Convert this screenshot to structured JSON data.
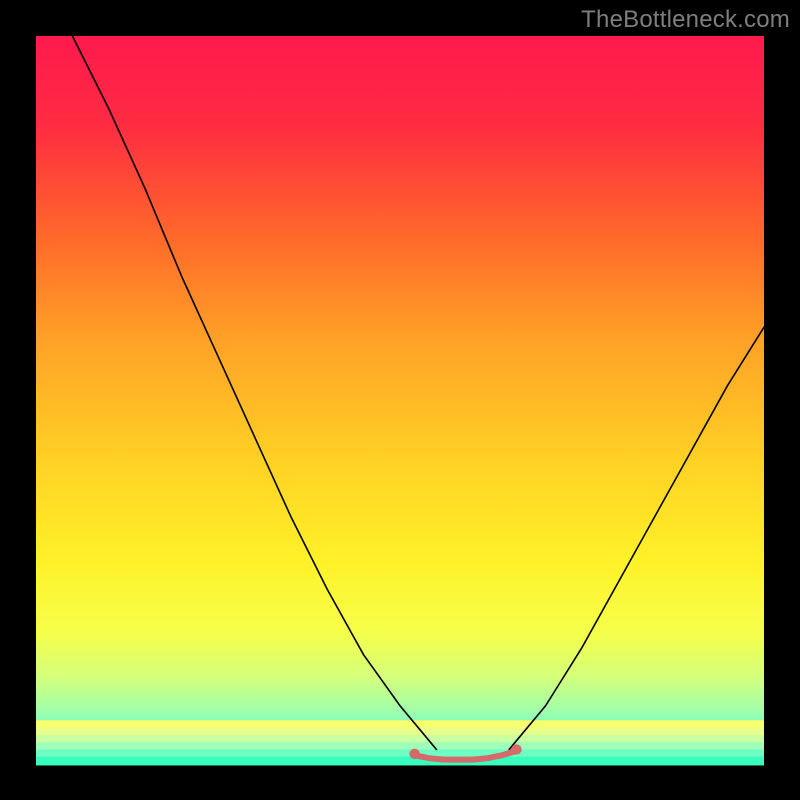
{
  "watermark": "TheBottleneck.com",
  "chart_data": {
    "type": "line",
    "title": "",
    "xlabel": "",
    "ylabel": "",
    "xlim": [
      0,
      100
    ],
    "ylim": [
      0,
      100
    ],
    "grid": false,
    "legend": false,
    "background": {
      "type": "vertical_gradient",
      "stops": [
        {
          "pos": 0.0,
          "color": "#ff1a4d"
        },
        {
          "pos": 0.12,
          "color": "#ff2b42"
        },
        {
          "pos": 0.28,
          "color": "#ff6a2a"
        },
        {
          "pos": 0.42,
          "color": "#ffa226"
        },
        {
          "pos": 0.58,
          "color": "#ffd024"
        },
        {
          "pos": 0.72,
          "color": "#fff128"
        },
        {
          "pos": 0.82,
          "color": "#f5ff4a"
        },
        {
          "pos": 0.88,
          "color": "#d4ff7a"
        },
        {
          "pos": 0.93,
          "color": "#9cffae"
        },
        {
          "pos": 0.97,
          "color": "#4effc6"
        },
        {
          "pos": 1.0,
          "color": "#1fffb2"
        }
      ]
    },
    "bottom_bands": [
      {
        "y": 94,
        "color": "#f7ff6e"
      },
      {
        "y": 95,
        "color": "#e7ff8a"
      },
      {
        "y": 96,
        "color": "#c9ffa0"
      },
      {
        "y": 97,
        "color": "#a0ffb8"
      },
      {
        "y": 98,
        "color": "#6fffc4"
      },
      {
        "y": 99,
        "color": "#38ffbe"
      }
    ],
    "series": [
      {
        "name": "left_branch",
        "x": [
          5,
          10,
          15,
          20,
          25,
          30,
          35,
          40,
          45,
          50,
          55
        ],
        "y": [
          100,
          90,
          79,
          67,
          56,
          45,
          34,
          24,
          15,
          8,
          2
        ],
        "style": {
          "stroke": "#000000",
          "width": 1.6
        }
      },
      {
        "name": "right_branch",
        "x": [
          65,
          70,
          75,
          80,
          85,
          90,
          95,
          100
        ],
        "y": [
          2,
          8,
          16,
          25,
          34,
          43,
          52,
          60
        ],
        "style": {
          "stroke": "#000000",
          "width": 1.6
        }
      },
      {
        "name": "valley_floor",
        "x": [
          52,
          54,
          56,
          58,
          60,
          62,
          64,
          66
        ],
        "y": [
          1.2,
          0.8,
          0.6,
          0.6,
          0.6,
          0.8,
          1.2,
          1.8
        ],
        "style": {
          "stroke": "#d66a6a",
          "width": 6
        }
      }
    ],
    "marker_points": [
      {
        "x": 52,
        "y": 1.4
      },
      {
        "x": 66,
        "y": 2.0
      }
    ]
  }
}
